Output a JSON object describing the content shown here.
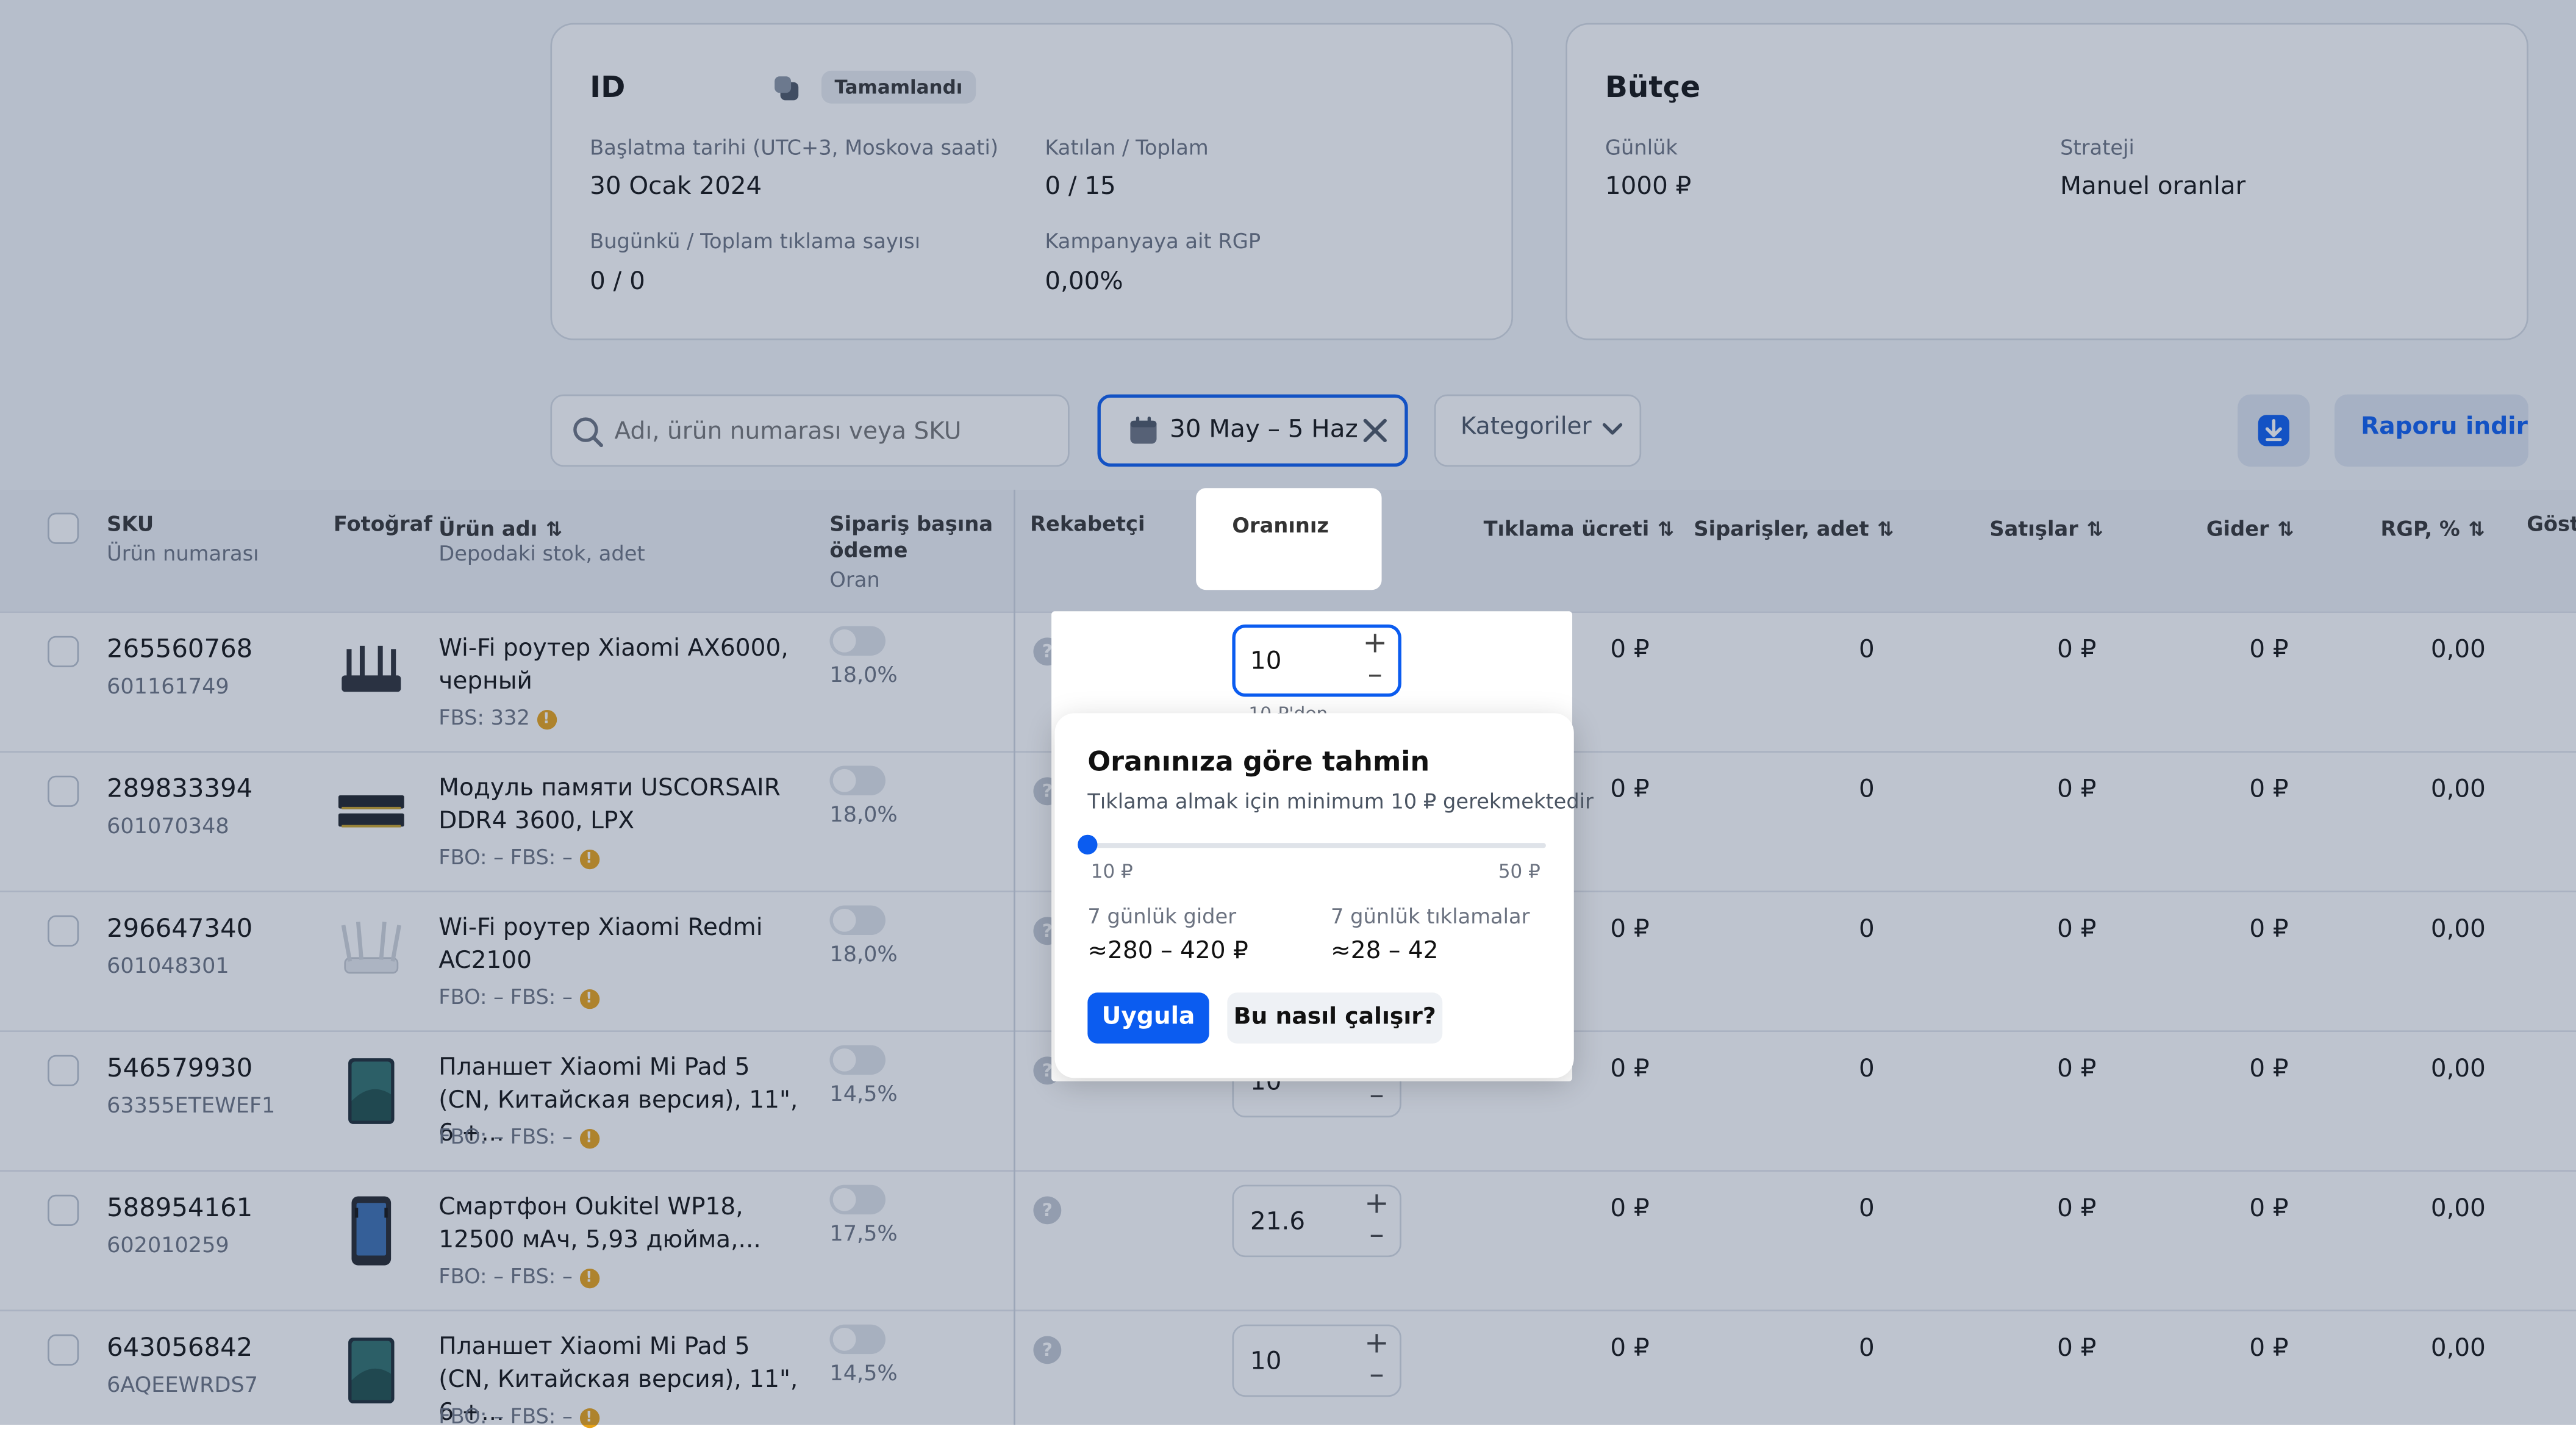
{
  "id_card": {
    "title": "ID",
    "status": "Tamamlandı",
    "start_label": "Başlatma tarihi (UTC+3, Moskova saati)",
    "start_value": "30 Ocak 2024",
    "joined_label": "Katılan / Toplam",
    "joined_value": "0 / 15",
    "clicks_label": "Bugünkü / Toplam tıklama sayısı",
    "clicks_value": "0 / 0",
    "rgp_label": "Kampanyaya ait RGP",
    "rgp_value": "0,00%"
  },
  "budget_card": {
    "title": "Bütçe",
    "daily_label": "Günlük",
    "daily_value": "1000 ₽",
    "strategy_label": "Strateji",
    "strategy_value": "Manuel oranlar"
  },
  "toolbar": {
    "search_placeholder": "Adı, ürün numarası veya SKU",
    "date_range": "30 May – 5 Haz",
    "categories": "Kategoriler",
    "report_button": "Raporu indir"
  },
  "table": {
    "headers": {
      "sku": "SKU",
      "sku_sub": "Ürün numarası",
      "photo": "Fotoğraf",
      "name": "Ürün adı",
      "name_sub": "Depodaki stok, adet",
      "pay_line1": "Sipariş başına",
      "pay_line2": "ödeme",
      "pay_sub": "Oran",
      "competitor": "Rekabetçi",
      "your_rate": "Oranınız",
      "click_cost": "Tıklama ücreti",
      "orders": "Siparişler, adet",
      "sales": "Satışlar",
      "expense": "Gider",
      "rgp": "RGP, %",
      "more": "Göst"
    },
    "rows": [
      {
        "sku": "265560768",
        "art": "601161749",
        "name": "Wi-Fi роутер Xiaomi AX6000, черный",
        "stock": "FBS: 332",
        "pct": "18,0%",
        "rate": "10",
        "click": "0 ₽",
        "orders": "0",
        "sales": "0 ₽",
        "expense": "0 ₽",
        "rgp": "0,00",
        "photo": "router-dark"
      },
      {
        "sku": "289833394",
        "art": "601070348",
        "name": "Модуль памяти USCORSAIR DDR4 3600, LPX",
        "stock": "FBO: –   FBS: –",
        "pct": "18,0%",
        "rate": "",
        "click": "0 ₽",
        "orders": "0",
        "sales": "0 ₽",
        "expense": "0 ₽",
        "rgp": "0,00",
        "photo": "ram"
      },
      {
        "sku": "296647340",
        "art": "601048301",
        "name": "Wi-Fi роутер Xiaomi Redmi AC2100",
        "stock": "FBO: –   FBS: –",
        "pct": "18,0%",
        "rate": "",
        "click": "0 ₽",
        "orders": "0",
        "sales": "0 ₽",
        "expense": "0 ₽",
        "rgp": "0,00",
        "photo": "router-white"
      },
      {
        "sku": "546579930",
        "art": "63355ETEWEF1",
        "name": "Планшет Xiaomi Mi Pad 5 (CN, Китайская версия), 11\", 6 +...",
        "stock": "FBO: –   FBS: –",
        "pct": "14,5%",
        "rate": "10",
        "click": "0 ₽",
        "orders": "0",
        "sales": "0 ₽",
        "expense": "0 ₽",
        "rgp": "0,00",
        "photo": "tablet"
      },
      {
        "sku": "588954161",
        "art": "602010259",
        "name": "Смартфон Oukitel WP18, 12500 мАч, 5,93 дюйма,...",
        "stock": "FBO: –   FBS: –",
        "pct": "17,5%",
        "rate": "21.6",
        "click": "0 ₽",
        "orders": "0",
        "sales": "0 ₽",
        "expense": "0 ₽",
        "rgp": "0,00",
        "photo": "phone"
      },
      {
        "sku": "643056842",
        "art": "6AQEEWRDS7",
        "name": "Планшет Xiaomi Mi Pad 5 (CN, Китайская версия), 11\", 6 +...",
        "stock": "FBO: –   FBS: –",
        "pct": "14,5%",
        "rate": "10",
        "click": "0 ₽",
        "orders": "0",
        "sales": "0 ₽",
        "expense": "0 ₽",
        "rgp": "0,00",
        "photo": "tablet"
      }
    ]
  },
  "popup": {
    "rate_value": "10",
    "min_hint": "10 ₽'den",
    "title": "Oranınıza göre tahmin",
    "subtitle": "Tıklama almak için minimum 10 ₽ gerekmektedir",
    "slider_min": "10 ₽",
    "slider_max": "50 ₽",
    "slider_value": 10,
    "expense_label": "7 günlük gider",
    "expense_value": "≈280 – 420 ₽",
    "clicks_label": "7 günlük tıklamalar",
    "clicks_value": "≈28 – 42",
    "apply_button": "Uygula",
    "how_button": "Bu nasıl çalışır?"
  },
  "colors": {
    "accent": "#0b5cf0",
    "warning": "#e8a317",
    "overlay": "rgba(40,60,95,0.30)"
  }
}
